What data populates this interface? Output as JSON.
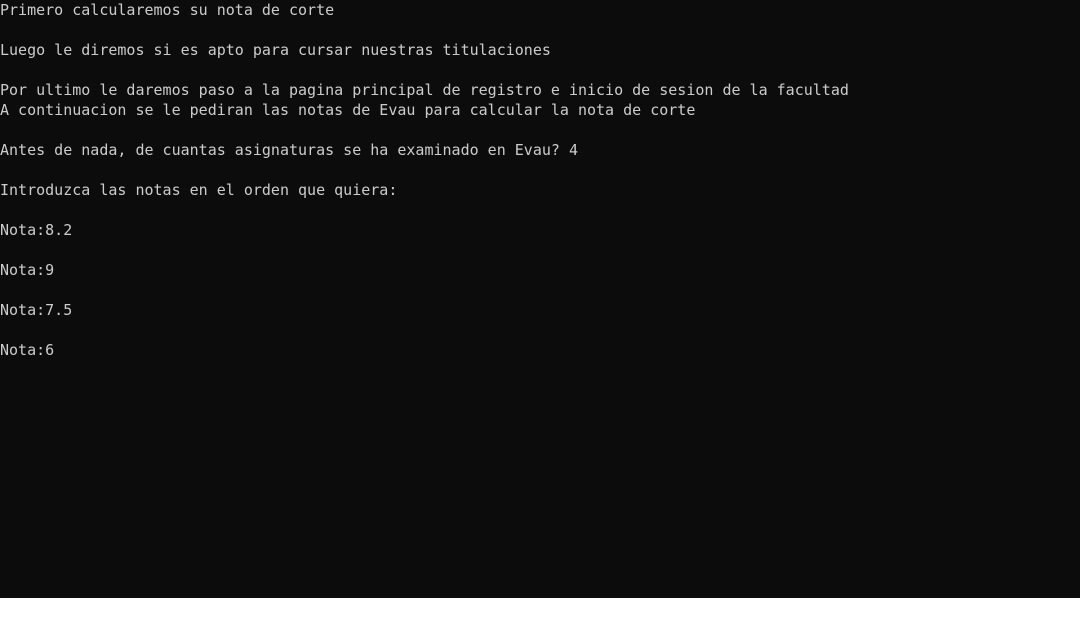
{
  "console": {
    "lines": [
      "Primero calcularemos su nota de corte",
      "",
      "Luego le diremos si es apto para cursar nuestras titulaciones",
      "",
      "Por ultimo le daremos paso a la pagina principal de registro e inicio de sesion de la facultad",
      "A continuacion se le pediran las notas de Evau para calcular la nota de corte",
      "",
      "Antes de nada, de cuantas asignaturas se ha examinado en Evau? 4",
      "",
      "Introduzca las notas en el orden que quiera:",
      "",
      "Nota:8.2",
      "",
      "Nota:9",
      "",
      "Nota:7.5",
      "",
      "Nota:6"
    ]
  },
  "colors": {
    "background": "#0c0c0c",
    "text": "#cccccc"
  }
}
